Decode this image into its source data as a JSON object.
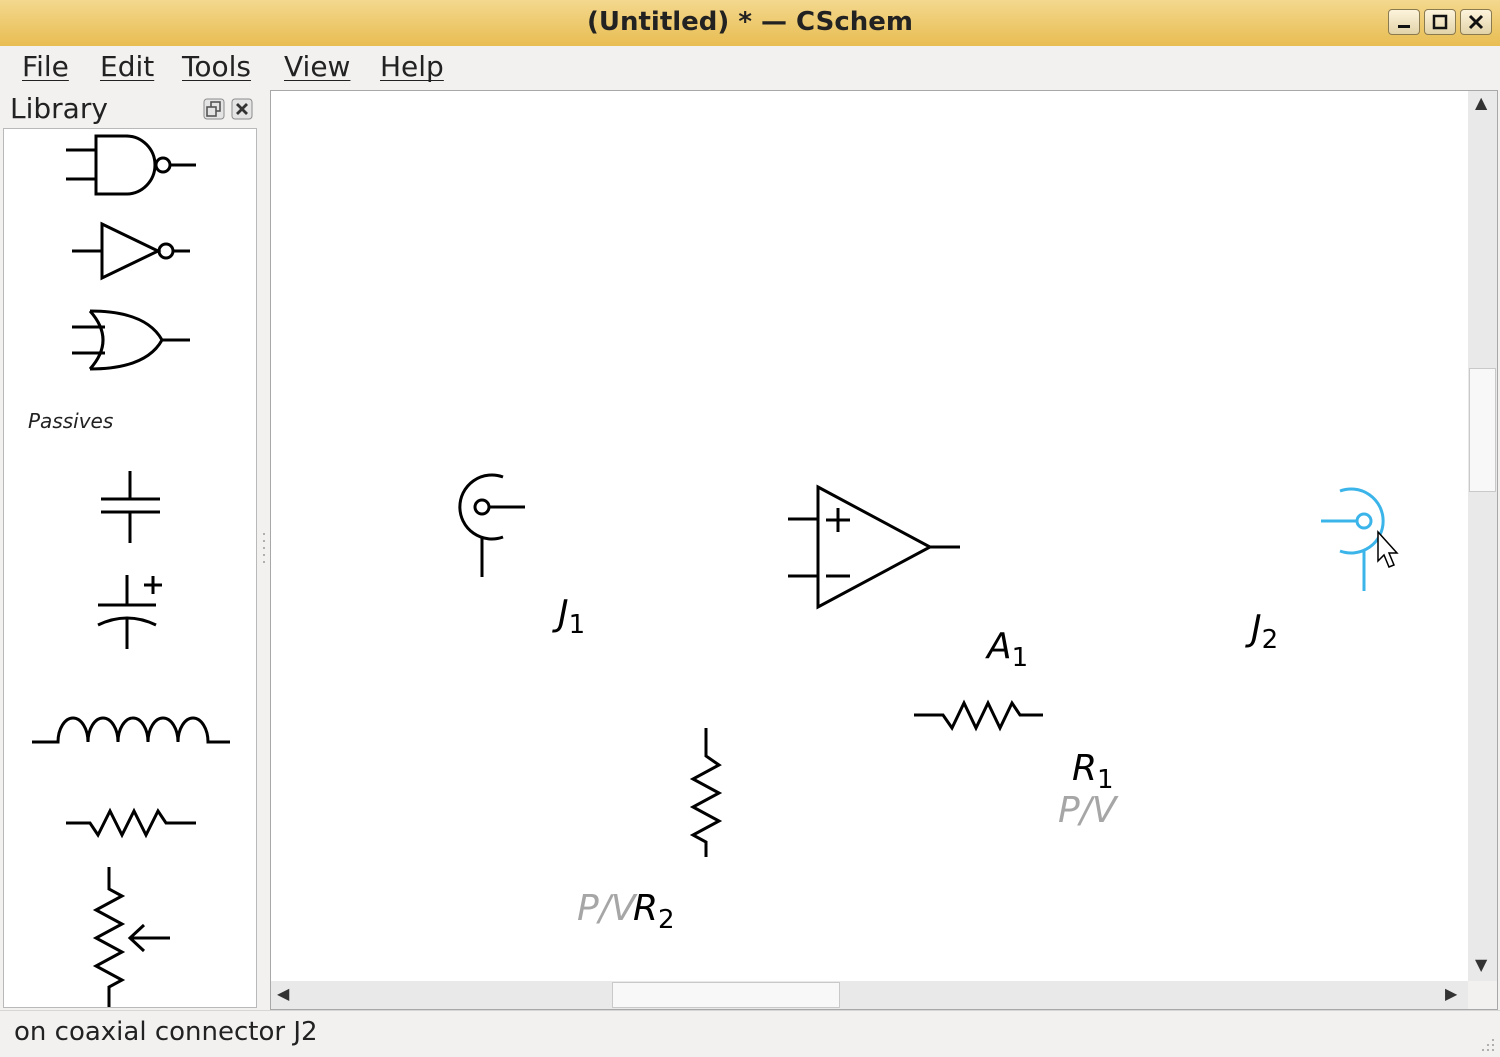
{
  "window": {
    "title": "(Untitled) * — CSchem"
  },
  "menu": [
    "File",
    "Edit",
    "Tools",
    "View",
    "Help"
  ],
  "library": {
    "title": "Library",
    "section_caption": "Passives",
    "symbols": [
      "nand-gate",
      "not-gate",
      "or-gate",
      "capacitor",
      "polarized-capacitor",
      "inductor",
      "resistor",
      "potentiometer"
    ]
  },
  "schematic": {
    "components": [
      {
        "ref": "J",
        "sub": "1",
        "type": "coaxial-connector"
      },
      {
        "ref": "A",
        "sub": "1",
        "type": "op-amp"
      },
      {
        "ref": "J",
        "sub": "2",
        "type": "coaxial-connector",
        "state": "hovered"
      },
      {
        "ref": "R",
        "sub": "1",
        "type": "resistor",
        "value": "P/V"
      },
      {
        "ref": "R",
        "sub": "2",
        "type": "resistor",
        "value": "P/V"
      }
    ]
  },
  "status": {
    "text": "on coaxial connector J2"
  },
  "colors": {
    "title_bar": "#e8bd52",
    "hover": "#3bb4ea",
    "value_text": "#a6a6a6"
  }
}
